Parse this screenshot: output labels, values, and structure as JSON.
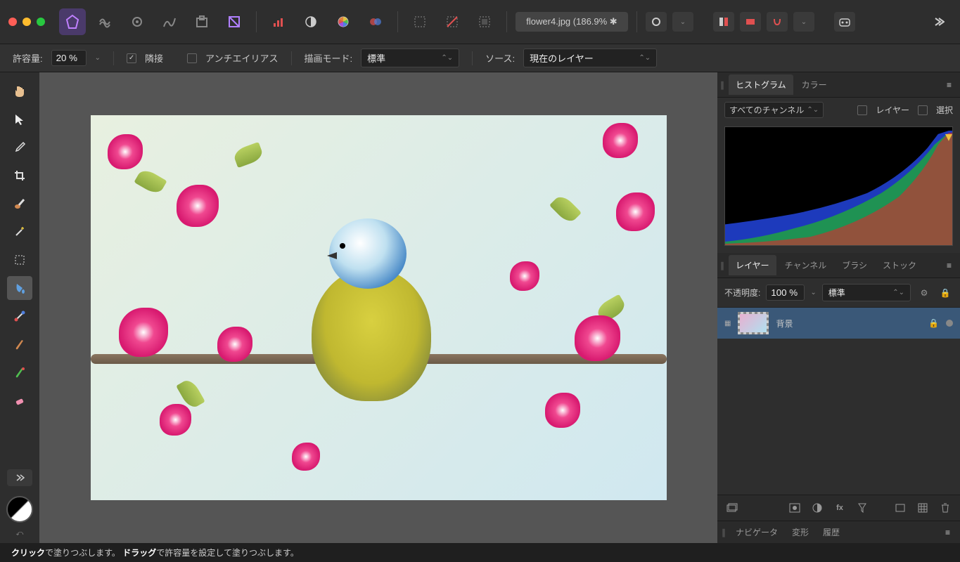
{
  "toolbar": {
    "file_title": "flower4.jpg (186.9% ✱"
  },
  "context": {
    "tolerance_label": "許容量:",
    "tolerance_value": "20 %",
    "contiguous_label": "隣接",
    "antialias_label": "アンチエイリアス",
    "draw_mode_label": "描画モード:",
    "draw_mode_value": "標準",
    "source_label": "ソース:",
    "source_value": "現在のレイヤー"
  },
  "panels": {
    "top_tabs": {
      "histogram": "ヒストグラム",
      "color": "カラー"
    },
    "hist_channels": "すべてのチャンネル",
    "hist_layer": "レイヤー",
    "hist_selection": "選択",
    "mid_tabs": {
      "layers": "レイヤー",
      "channels": "チャンネル",
      "brushes": "ブラシ",
      "stock": "ストック"
    },
    "opacity_label": "不透明度:",
    "opacity_value": "100 %",
    "blend_mode": "標準",
    "layer_name": "背景",
    "bottom_tabs": {
      "navigator": "ナビゲータ",
      "transform": "変形",
      "history": "履歴"
    }
  },
  "status": {
    "click_bold": "クリック",
    "click_rest": "で塗りつぶします。",
    "drag_bold": "ドラッグ",
    "drag_rest": "で許容量を設定して塗りつぶします。"
  }
}
